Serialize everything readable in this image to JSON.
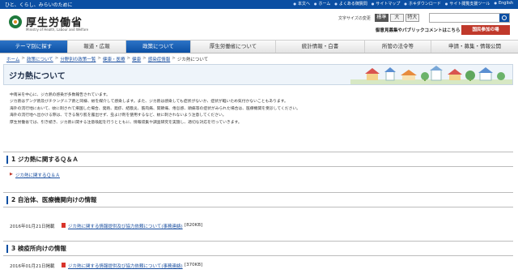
{
  "topbar": {
    "tagline": "ひと、くらし、みらいのために",
    "links": [
      "本文へ",
      "ホーム",
      "よくある御質問",
      "サイトマップ",
      "ホキダウンロード",
      "サイト閲覧支援ツール",
      "English"
    ]
  },
  "header": {
    "ministry_name": "厚生労働省",
    "ministry_en": "Ministry of Health, Labour and Welfare",
    "font_size_label": "文字サイズの変更",
    "font_sizes": [
      "標準",
      "大",
      "特大"
    ],
    "search_placeholder": "",
    "opinion_link": "御意見募集やパブリックコメントはこちら",
    "participate_button": "国民参加の場"
  },
  "nav": {
    "items": [
      "テーマ別に探す",
      "報道・広報",
      "政策について",
      "厚生労働省について",
      "統計情報・白書",
      "所管の法令等",
      "申請・募集・情報公開"
    ]
  },
  "breadcrumb": [
    "ホーム",
    "政策について",
    "分野別の政策一覧",
    "健康・医療",
    "健康",
    "感染症情報",
    "ジカ熱について"
  ],
  "page_title": "ジカ熱について",
  "intro": [
    "中南米を中心に、ジカ熱の感染が多数報告されています。",
    "ジカ熱はデング熱及びチクングニア熱と同様、蚊を媒介して感染します。また、ジカ熱は感染しても症状がないか、症状が軽いため気付かないこともあります。",
    "海外の流行地において、蚊に刺されて帰国した場合、発熱、発疹、結膜炎、筋肉痛、関節痛、倦怠感、頭痛等の症状がみられた場合は、医療機関を受診してください。",
    "海外の流行地へ出かける際は、できる限り肌を露出せず、虫よけ剤を使用するなど、蚊に刺されないよう注意してください。",
    "厚生労働省では、引き続き、ジカ熱に関する注意喚起を行うとともに、情報収集や調査研究を実施し、適切な対応を行っていきます。"
  ],
  "sections": [
    {
      "title": "1 ジカ熱に関するＱ＆Ａ",
      "date": "",
      "link": "ジカ熱に関するＱ＆Ａ",
      "size": ""
    },
    {
      "title": "2 自治体、医療機関向けの情報",
      "date": "2016年01月21日掲載",
      "link": "ジカ熱に関する情報提供及び協力依頼について(事務連絡)",
      "size": "[820KB]"
    },
    {
      "title": "3 検疫所向けの情報",
      "date": "2016年01月21日掲載",
      "link": "ジカ熱に関する情報提供及び協力依頼について(事務連絡)",
      "size": "[370KB]"
    }
  ],
  "colors": {
    "brand_blue": "#0b4fa3",
    "accent_red": "#c0392b",
    "link": "#1a4fa0"
  }
}
